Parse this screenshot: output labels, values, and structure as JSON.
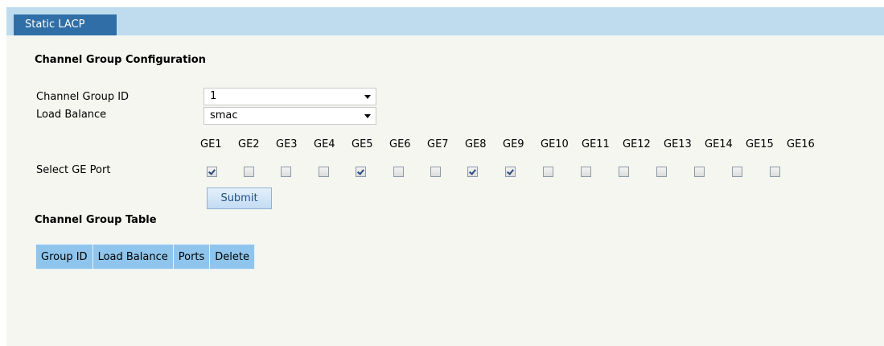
{
  "tab": {
    "label": "Static LACP"
  },
  "config": {
    "title": "Channel Group Configuration",
    "group_id_label": "Channel Group ID",
    "group_id_value": "1",
    "load_balance_label": "Load Balance",
    "load_balance_value": "smac",
    "select_port_label": "Select GE Port",
    "submit_label": "Submit"
  },
  "ports": [
    {
      "name": "GE1",
      "checked": true
    },
    {
      "name": "GE2",
      "checked": false
    },
    {
      "name": "GE3",
      "checked": false
    },
    {
      "name": "GE4",
      "checked": false
    },
    {
      "name": "GE5",
      "checked": true
    },
    {
      "name": "GE6",
      "checked": false
    },
    {
      "name": "GE7",
      "checked": false
    },
    {
      "name": "GE8",
      "checked": true
    },
    {
      "name": "GE9",
      "checked": true
    },
    {
      "name": "GE10",
      "checked": false
    },
    {
      "name": "GE11",
      "checked": false
    },
    {
      "name": "GE12",
      "checked": false
    },
    {
      "name": "GE13",
      "checked": false
    },
    {
      "name": "GE14",
      "checked": false
    },
    {
      "name": "GE15",
      "checked": false
    },
    {
      "name": "GE16",
      "checked": false
    }
  ],
  "table": {
    "title": "Channel Group Table",
    "headers": [
      "Group ID",
      "Load Balance",
      "Ports",
      "Delete"
    ]
  }
}
